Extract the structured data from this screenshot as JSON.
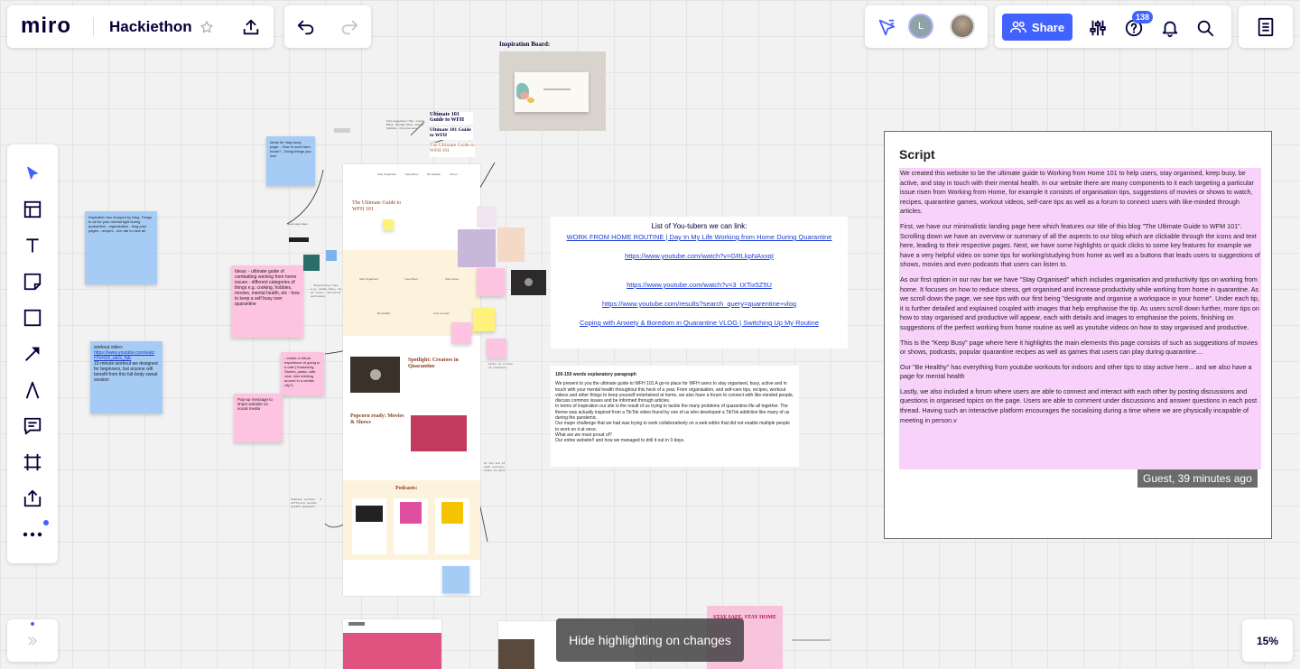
{
  "app": {
    "logo": "miro",
    "board_title": "Hackiethon",
    "icons": {
      "star": "star-icon",
      "upload": "upload-icon",
      "undo": "undo-icon",
      "redo": "redo-icon"
    }
  },
  "collab": {
    "avatar_initial": "L",
    "share_label": "Share",
    "notification_count": "138",
    "accent": "#4262ff"
  },
  "toolbar": {
    "tools": [
      "select",
      "templates",
      "text",
      "sticky-note",
      "shape",
      "connection-line",
      "pen",
      "comment",
      "frame",
      "upload",
      "more"
    ]
  },
  "zoom": {
    "level": "15%"
  },
  "toast": {
    "text": "Hide highlighting on changes"
  },
  "canvas": {
    "inspiration_label": "Inspiration Board:",
    "youtubers": {
      "title": "List of You-tubers we can link:",
      "links": [
        "WORK FROM HOME ROUTINE | Day In My Life Working from Home During Quarantine",
        "https://www.youtube.com/watch?v=GRLkpNAxxqI",
        "https://www.youtube.com/watch?v=3_tXTix5Z5U",
        "https://www.youtube.com/results?search_query=quarentine+vlog",
        "Coping with Anxiety & Boredom in Quarantine VLOG | Switching Up My Routine"
      ]
    },
    "explanatory": {
      "title": "100-150 words explanatory paragraph",
      "lines": [
        "We present to you the ultimate guide to WFH 101 A go-to place for WFH users to stay organised, busy, active and in touch with your mental health throughout this heck of a year. From organisation, and self-care tips, recipes, workout videos and other things to keep yourself entertained at home, we also have a forum to connect with like-minded people, discuss common issues and be informed through articles.",
        "In terms of inspiration our site is the result of us trying to tackle the many problems of quarantine life all together. The theme was actually inspired from a TikTok video found by one of us who developed a TikTok addiction like many of us during the pandemic.",
        "Our major challenge that we had was trying to work collaboratively on a web editor that did not enable multiple people to work on it at once.",
        "What are we most proud of?",
        "Our entire website!! and how we managed to drill it out in 3 days."
      ]
    },
    "sticky_workout": {
      "title": "workout video:",
      "link": "https://www.youtube.com/watch?v=GX_eEG_fqE",
      "body": "15-minute workout we designed for beginners, but anyone will benefit from this full-body sweat session"
    },
    "sticky_ideas": "Ideas: - ultimate guide of combatting working from home issues - different categories of things e.g. cooking, hobbies, movies, mental health, etc - how to keep a self busy over quarantine",
    "sticky_forum": "- create a virtual experience of going to a cafe (Youtube/Ig, Stories, pasta, cafe, chat, mini drinking around in a certain city?)",
    "sticky_popup": "Pop-up message to share website on social media",
    "sticky_left": "Inspiration box dropped by Meg: Things to do for your mental light during quarantine - organisation - blog post pages - recipes - one tab to view all",
    "sticky_blue_small": "Ideas for 'stay busy' page: - How to work from home? - Doing things you love",
    "wf_title": "The Ultimate Guide to WFH 101",
    "wf_spotlight": "Spotlight: Creators in Quarantine",
    "wf_popcorn": "Popcorn ready: Movies & Shows",
    "wf_podcasts": "Podcasts:",
    "wf_nav": [
      "Stay Organised",
      "Keep Busy",
      "Be Healthy",
      "Forum"
    ],
    "wf_mid_labels": [
      "Stay Organised",
      "Keep Busy",
      "Stay Active"
    ],
    "wf_mid_labels2": [
      "Be Healthy",
      "How to Learn"
    ],
    "notes_titles": [
      "Ultimate 101 Guide to WFH",
      "Ultimate 101 Guide to WFH",
      "The Ultimate Guide to WFH 101"
    ],
    "notes_left": "Font suggestions: Title - Cooper Black - Monday Vibes - Pepper Subtitles - 40 Is plus sans",
    "stay_safe": "STAY SAFE, STAY HOME"
  },
  "script": {
    "title": "Script",
    "paragraphs": [
      "We created this website to be the ultimate guide to Working from Home 101 to help users, stay organised, keep busy, be active, and stay in touch with their mental health. In our website there are many components to it each targeting a particular issue risen from Working from Home, for example it consists of organisation tips, suggestions of movies or shows to watch, recipes, quarantine games, workout videos, self-care tips as well as a forum to connect users with like-minded through articles.",
      "First, we have our minimalistic landing page here which features our title of this blog \"The Ultimate Guide to WFM 101\". Scrolling down we have an overview or summary of all the aspects to our blog which are clickable through the icons and text here, leading to their respective pages. Next, we have some highlights or quick clicks to some key features for example we have a very helpful video on some tips for working/studying from home as well as a buttons that leads users to suggestions of shows, movies and even podcasts that users can listen to.",
      "As our first option in our nav bar we have \"Stay Organised\" which includes organisation and productivity tips on working from home. It focuses on how to reduce stress, get organised and increase productivity while working from home in quarantine. As we scroll down the page, we see tips with our first being \"designate and organise a workspace in your home\". Under each tip, it is further detailed and explained coupled with images that help emphasise the tip. As users scroll down further, more tips on how to stay organised and productive will appear, each with details and images to emphasise the points, finishing on suggestions of the perfect working from home routine as well as youtube videos on how to stay organised and productive.",
      "This is the \"Keep Busy\" page where here it highlights the main elements this page consists of such as suggestions of movies or shows, podcasts, popular quarantine recipes as well as games that users can play during quarantine....",
      "Our \"Be Healthy\" has everything from youtube workouts for indoors and other tips to stay active here... and we also have a page for mental health",
      "Lastly, we also included a forum where users are able to connect and interact with each other by posting discussions and questions in organised topics on the page. Users are able to comment under discussions and answer questions in each post thread. Having such an interactive platform encourages the socialising during a time where we are physically incapable of meeting in person.v"
    ],
    "guest_tag": "Guest, 39 minutes ago",
    "highlight_color": "#f9d2fb"
  }
}
